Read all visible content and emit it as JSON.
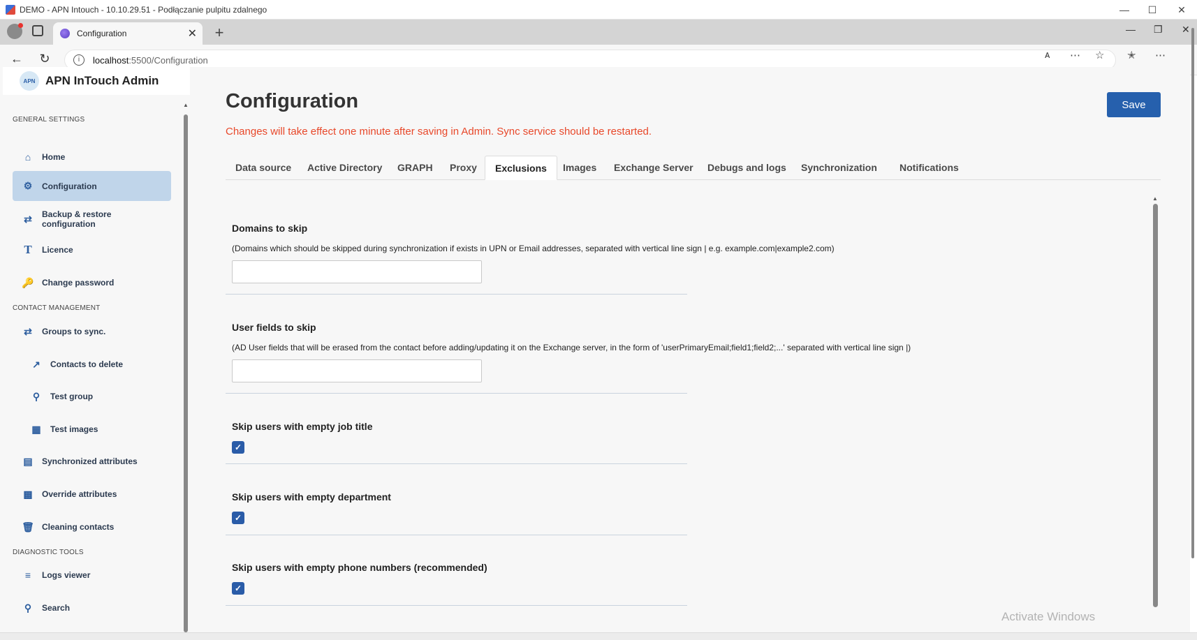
{
  "window": {
    "title": "DEMO - APN Intouch - 10.10.29.51 - Podłączanie pulpitu zdalnego"
  },
  "browser": {
    "tab_title": "Configuration",
    "url_host": "localhost",
    "url_path": ":5500/Configuration"
  },
  "sidebar": {
    "brand_logo": "APN",
    "brand_title": "APN InTouch Admin",
    "sections": {
      "general": "GENERAL SETTINGS",
      "contact": "CONTACT MANAGEMENT",
      "diagnostic": "DIAGNOSTIC TOOLS"
    },
    "items": [
      {
        "label": "Home",
        "icon": "home-icon"
      },
      {
        "label": "Configuration",
        "icon": "gear-icon"
      },
      {
        "label": "Backup & restore configuration",
        "icon": "swap-icon"
      },
      {
        "label": "Licence",
        "icon": "text-t-icon"
      },
      {
        "label": "Change password",
        "icon": "key-icon"
      },
      {
        "label": "Groups to sync.",
        "icon": "swap-icon"
      },
      {
        "label": "Contacts to delete",
        "icon": "export-icon"
      },
      {
        "label": "Test group",
        "icon": "flask-icon"
      },
      {
        "label": "Test images",
        "icon": "image-icon"
      },
      {
        "label": "Synchronized attributes",
        "icon": "table-icon"
      },
      {
        "label": "Override attributes",
        "icon": "override-icon"
      },
      {
        "label": "Cleaning contacts",
        "icon": "trash-icon"
      },
      {
        "label": "Logs viewer",
        "icon": "list-icon"
      },
      {
        "label": "Search",
        "icon": "search-icon"
      }
    ]
  },
  "main": {
    "title": "Configuration",
    "warning": "Changes will take effect one minute after saving in Admin. Sync service should be restarted.",
    "save_label": "Save",
    "tabs": [
      "Data source",
      "Active Directory",
      "GRAPH",
      "Proxy",
      "Exclusions",
      "Images",
      "Exchange Server",
      "Debugs and logs",
      "Synchronization",
      "Notifications"
    ],
    "active_tab": "Exclusions",
    "fields": {
      "domains": {
        "title": "Domains to skip",
        "desc": "(Domains which should be skipped during synchronization if exists in UPN or Email addresses, separated with vertical line sign | e.g. example.com|example2.com)",
        "value": ""
      },
      "userfields": {
        "title": "User fields to skip",
        "desc": "(AD User fields that will be erased from the contact before adding/updating it on the Exchange server, in the form of 'userPrimaryEmail;field1;field2;...' separated with vertical line sign |)",
        "value": ""
      },
      "jobtitle": {
        "title": "Skip users with empty job title",
        "checked": true
      },
      "department": {
        "title": "Skip users with empty department",
        "checked": true
      },
      "phone": {
        "title": "Skip users with empty phone numbers (recommended)",
        "checked": true
      }
    }
  },
  "watermark": "Activate Windows",
  "colors": {
    "accent": "#2660ad",
    "warning": "#e8482a",
    "active_nav": "#c0d5ea"
  }
}
